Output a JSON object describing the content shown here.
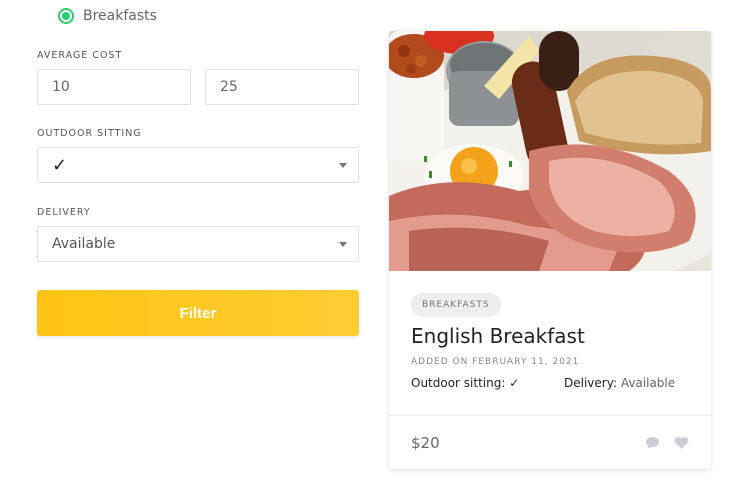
{
  "category_radio": {
    "label": "Breakfasts",
    "selected": true
  },
  "average_cost": {
    "label": "AVERAGE COST",
    "min": "10",
    "max": "25"
  },
  "outdoor_sitting": {
    "label": "OUTDOOR SITTING",
    "value": "✓"
  },
  "delivery": {
    "label": "DELIVERY",
    "value": "Available"
  },
  "filter_button": {
    "label": "Filter"
  },
  "card": {
    "badge": "BREAKFASTS",
    "title": "English Breakfast",
    "date": "ADDED ON FEBRUARY 11, 2021",
    "outdoor_label": "Outdoor sitting:",
    "outdoor_value": "✓",
    "delivery_label": "Delivery:",
    "delivery_value": "Available",
    "price": "$20",
    "icons": [
      "comment-icon",
      "heart-icon"
    ]
  },
  "colors": {
    "accent": "#ffc414",
    "radio": "#2ecc71"
  }
}
